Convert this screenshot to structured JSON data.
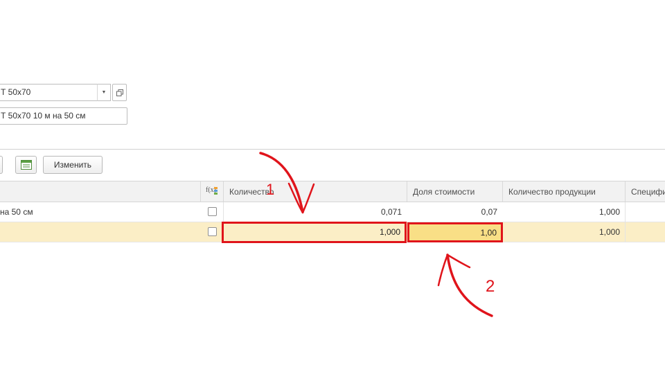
{
  "form": {
    "field1_value": "Т 50х70",
    "field2_value": "Т 50х70 10 м на 50 см"
  },
  "toolbar": {
    "edit_label": "Изменить"
  },
  "table": {
    "columns": [
      "Количество",
      "Доля стоимости",
      "Количество продукции",
      "Специфи"
    ],
    "rows": [
      {
        "name": "на 50 см",
        "quantity": "0,071",
        "cost_share": "0,07",
        "product_quantity": "1,000"
      },
      {
        "name": "",
        "quantity": "1,000",
        "cost_share": "1,00",
        "product_quantity": "1,000"
      }
    ]
  },
  "annotations": {
    "label1": "1",
    "label2": "2",
    "color": "#e0141b"
  },
  "colors": {
    "selected_row": "#fbeec6",
    "active_cell": "#f9df86"
  }
}
